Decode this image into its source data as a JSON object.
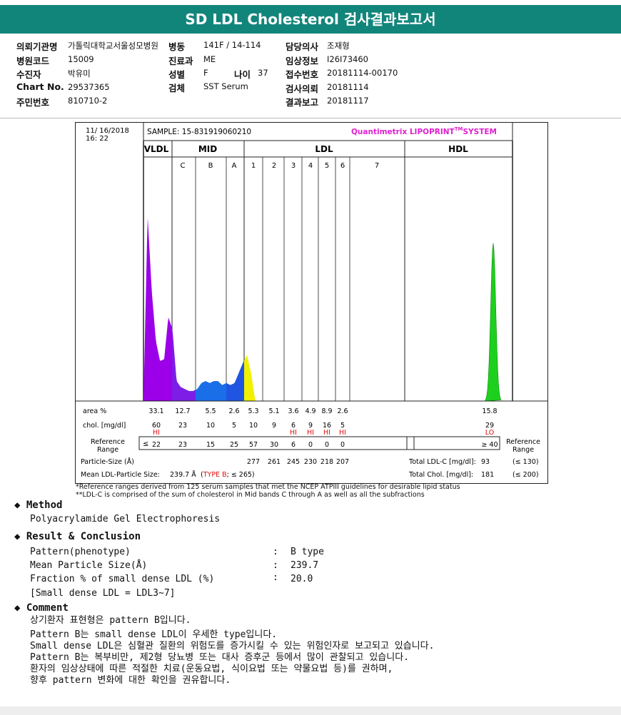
{
  "title": "SD LDL Cholesterol 검사결과보고서",
  "info": {
    "req_org_label": "의뢰기관명",
    "req_org": "가톨릭대학교서울성모병원",
    "ward_label": "병동",
    "ward": "141F / 14-114",
    "doctor_label": "담당의사",
    "doctor": "조재형",
    "hosp_code_label": "병원코드",
    "hosp_code": "15009",
    "dept_label": "진료과",
    "dept": "ME",
    "clinical_label": "임상정보",
    "clinical": "I26I73460",
    "patient_label": "수진자",
    "patient": "박유미",
    "sex_label": "성별",
    "sex": "F",
    "age_label": "나이",
    "age": "37",
    "receipt_label": "접수번호",
    "receipt": "20181114-00170",
    "chart_label": "Chart No.",
    "chart": "29537365",
    "specimen_label": "검체",
    "specimen": "SST Serum",
    "test_req_label": "검사의뢰",
    "test_req": "20181114",
    "rrn_label": "주민번호",
    "rrn": "810710-2",
    "report_label": "결과보고",
    "report": "20181117"
  },
  "chart_data": {
    "type": "area",
    "date": "11/ 16/2018",
    "time": "16: 22",
    "sample": "SAMPLE:   15-831919060210",
    "system": "Quantimetrix LIPOPRINT",
    "system_tm": "TM",
    "system_suffix": "SYSTEM",
    "group_labels": [
      "VLDL",
      "MID",
      "LDL",
      "HDL"
    ],
    "subband_labels": [
      "C",
      "B",
      "A",
      "1",
      "2",
      "3",
      "4",
      "5",
      "6",
      "7"
    ],
    "bands": [
      "VLDL",
      "MID C",
      "MID B",
      "MID A",
      "LDL1",
      "LDL2",
      "LDL3",
      "LDL4",
      "LDL5",
      "LDL6",
      "LDL7",
      "HDL"
    ],
    "colors": {
      "VLDL": "#9b00e8",
      "MID C": "#7c1ee6",
      "MID B": "#1a6ee8",
      "MID A": "#1f55e0",
      "LDL1": "#f0f000",
      "LDL2": "#ffc000",
      "LDL3": "#ee1a20",
      "LDL4": "#ee1a28",
      "LDL5": "#ee1a40",
      "LDL6": "#ee1a40",
      "HDL": "#1ed01e",
      "title_magenta": "#e020d0",
      "flag_red": "#e01010",
      "header_teal": "#12857b"
    },
    "area_label": "area %",
    "area": [
      "33.1",
      "12.7",
      "5.5",
      "2.6",
      "5.3",
      "5.1",
      "3.6",
      "4.9",
      "8.9",
      "2.6",
      "",
      "15.8"
    ],
    "chol_label": "chol. [mg/dl]",
    "chol": [
      "60",
      "23",
      "10",
      "5",
      "10",
      "9",
      "6",
      "9",
      "16",
      "5",
      "",
      "29"
    ],
    "chol_flags": [
      "HI",
      "",
      "",
      "",
      "",
      "",
      "HI",
      "HI",
      "HI",
      "HI",
      "",
      "LO"
    ],
    "ref_label": [
      "Reference",
      "Range"
    ],
    "ref_prefix": "≤",
    "ref": [
      "22",
      "23",
      "15",
      "25",
      "57",
      "30",
      "6",
      "0",
      "0",
      "0",
      "",
      "≥ 40"
    ],
    "ref_right_label": [
      "Reference",
      "Range"
    ],
    "particle_label": "Particle-Size (Å)",
    "particle": [
      "",
      "",
      "",
      "",
      "277",
      "261",
      "245",
      "230",
      "218",
      "207",
      "",
      ""
    ],
    "mean_ldl_label": "Mean LDL-Particle Size:",
    "mean_ldl_value": "239.7 Å",
    "mean_ldl_type_open": "(",
    "mean_ldl_type": "TYPE B",
    "mean_ldl_type_close": "; ≤ 265)",
    "total_ldl_label": "Total LDL-C [mg/dl]:",
    "total_ldl_value": "93",
    "total_ldl_ref": "(≤ 130)",
    "total_chol_label": "Total Chol. [mg/dl]:",
    "total_chol_value": "181",
    "total_chol_ref": "(≤ 200)",
    "curve_mobility": [
      0,
      0.02,
      0.04,
      0.06,
      0.08,
      0.1,
      0.12,
      0.14,
      0.16,
      0.18,
      0.2,
      0.22,
      0.24,
      0.26,
      0.28,
      0.3,
      0.32,
      0.34,
      0.36,
      0.38,
      0.4,
      0.42,
      0.44,
      0.46,
      0.48,
      0.5,
      0.52,
      0.54,
      0.56,
      0.58,
      0.6,
      0.62,
      0.64,
      0.66,
      0.68,
      0.7,
      0.72,
      0.74,
      0.76,
      0.78,
      0.8,
      0.82,
      0.84,
      0.86,
      0.88,
      0.9,
      0.92,
      0.94,
      0.96,
      0.98,
      1.0
    ],
    "curve_intensity": [
      0.0,
      0.93,
      0.55,
      0.3,
      0.2,
      0.21,
      0.42,
      0.36,
      0.1,
      0.07,
      0.06,
      0.05,
      0.05,
      0.06,
      0.09,
      0.1,
      0.09,
      0.1,
      0.1,
      0.08,
      0.09,
      0.08,
      0.09,
      0.14,
      0.19,
      0.23,
      0.14,
      0.0,
      0.0,
      0.0,
      0.0,
      0.0,
      0.0,
      0.0,
      0.0,
      0.0,
      0.0,
      0.0,
      0.0,
      0.0,
      0.0,
      0.0,
      0.0,
      0.0,
      0.0,
      0.0,
      0.0,
      0.0,
      0.0,
      0.0,
      0.0
    ],
    "hdl_peak_intensity": 0.79
  },
  "footnotes": [
    "*Reference ranges derived from 125 serum samples that met the NCEP ATPIII guidelines for desirable lipid status",
    "**LDL-C is comprised of the sum of cholesterol in Mid bands C through A as well as all the subfractions"
  ],
  "method": {
    "heading": "Method",
    "text": "Polyacrylamide Gel Electrophoresis"
  },
  "result": {
    "heading": "Result & Conclusion",
    "rows": [
      {
        "label": "Pattern(phenotype)",
        "sep": ":",
        "value": "B type"
      },
      {
        "label": "Mean Particle Size(Å)",
        "sep": ":",
        "value": "239.7"
      },
      {
        "label": "Fraction % of small dense LDL (%)",
        "sep": ":",
        "value": "20.0"
      }
    ],
    "note": "[Small dense LDL = LDL3~7]"
  },
  "comment": {
    "heading": "Comment",
    "lines": [
      "상기환자 표현형은 pattern B입니다.",
      "Pattern B는 small dense LDL이 우세한 type입니다.",
      "Small dense LDL은 심혈관 질환의 위험도를 증가시킬 수 있는 위험인자로 보고되고 있습니다.",
      "Pattern B는 복부비만, 제2형 당뇨병 또는 대사 증후군 등에서 많이 관찰되고 있습니다.",
      "환자의 임상상태에 따른 적절한 치료(운동요법, 식이요법 또는 약물요법 등)를 권하며,",
      "향후 pattern 변화에 대한 확인을 권유합니다."
    ]
  },
  "icons": {
    "bullet": "diamond-bullet-icon"
  }
}
